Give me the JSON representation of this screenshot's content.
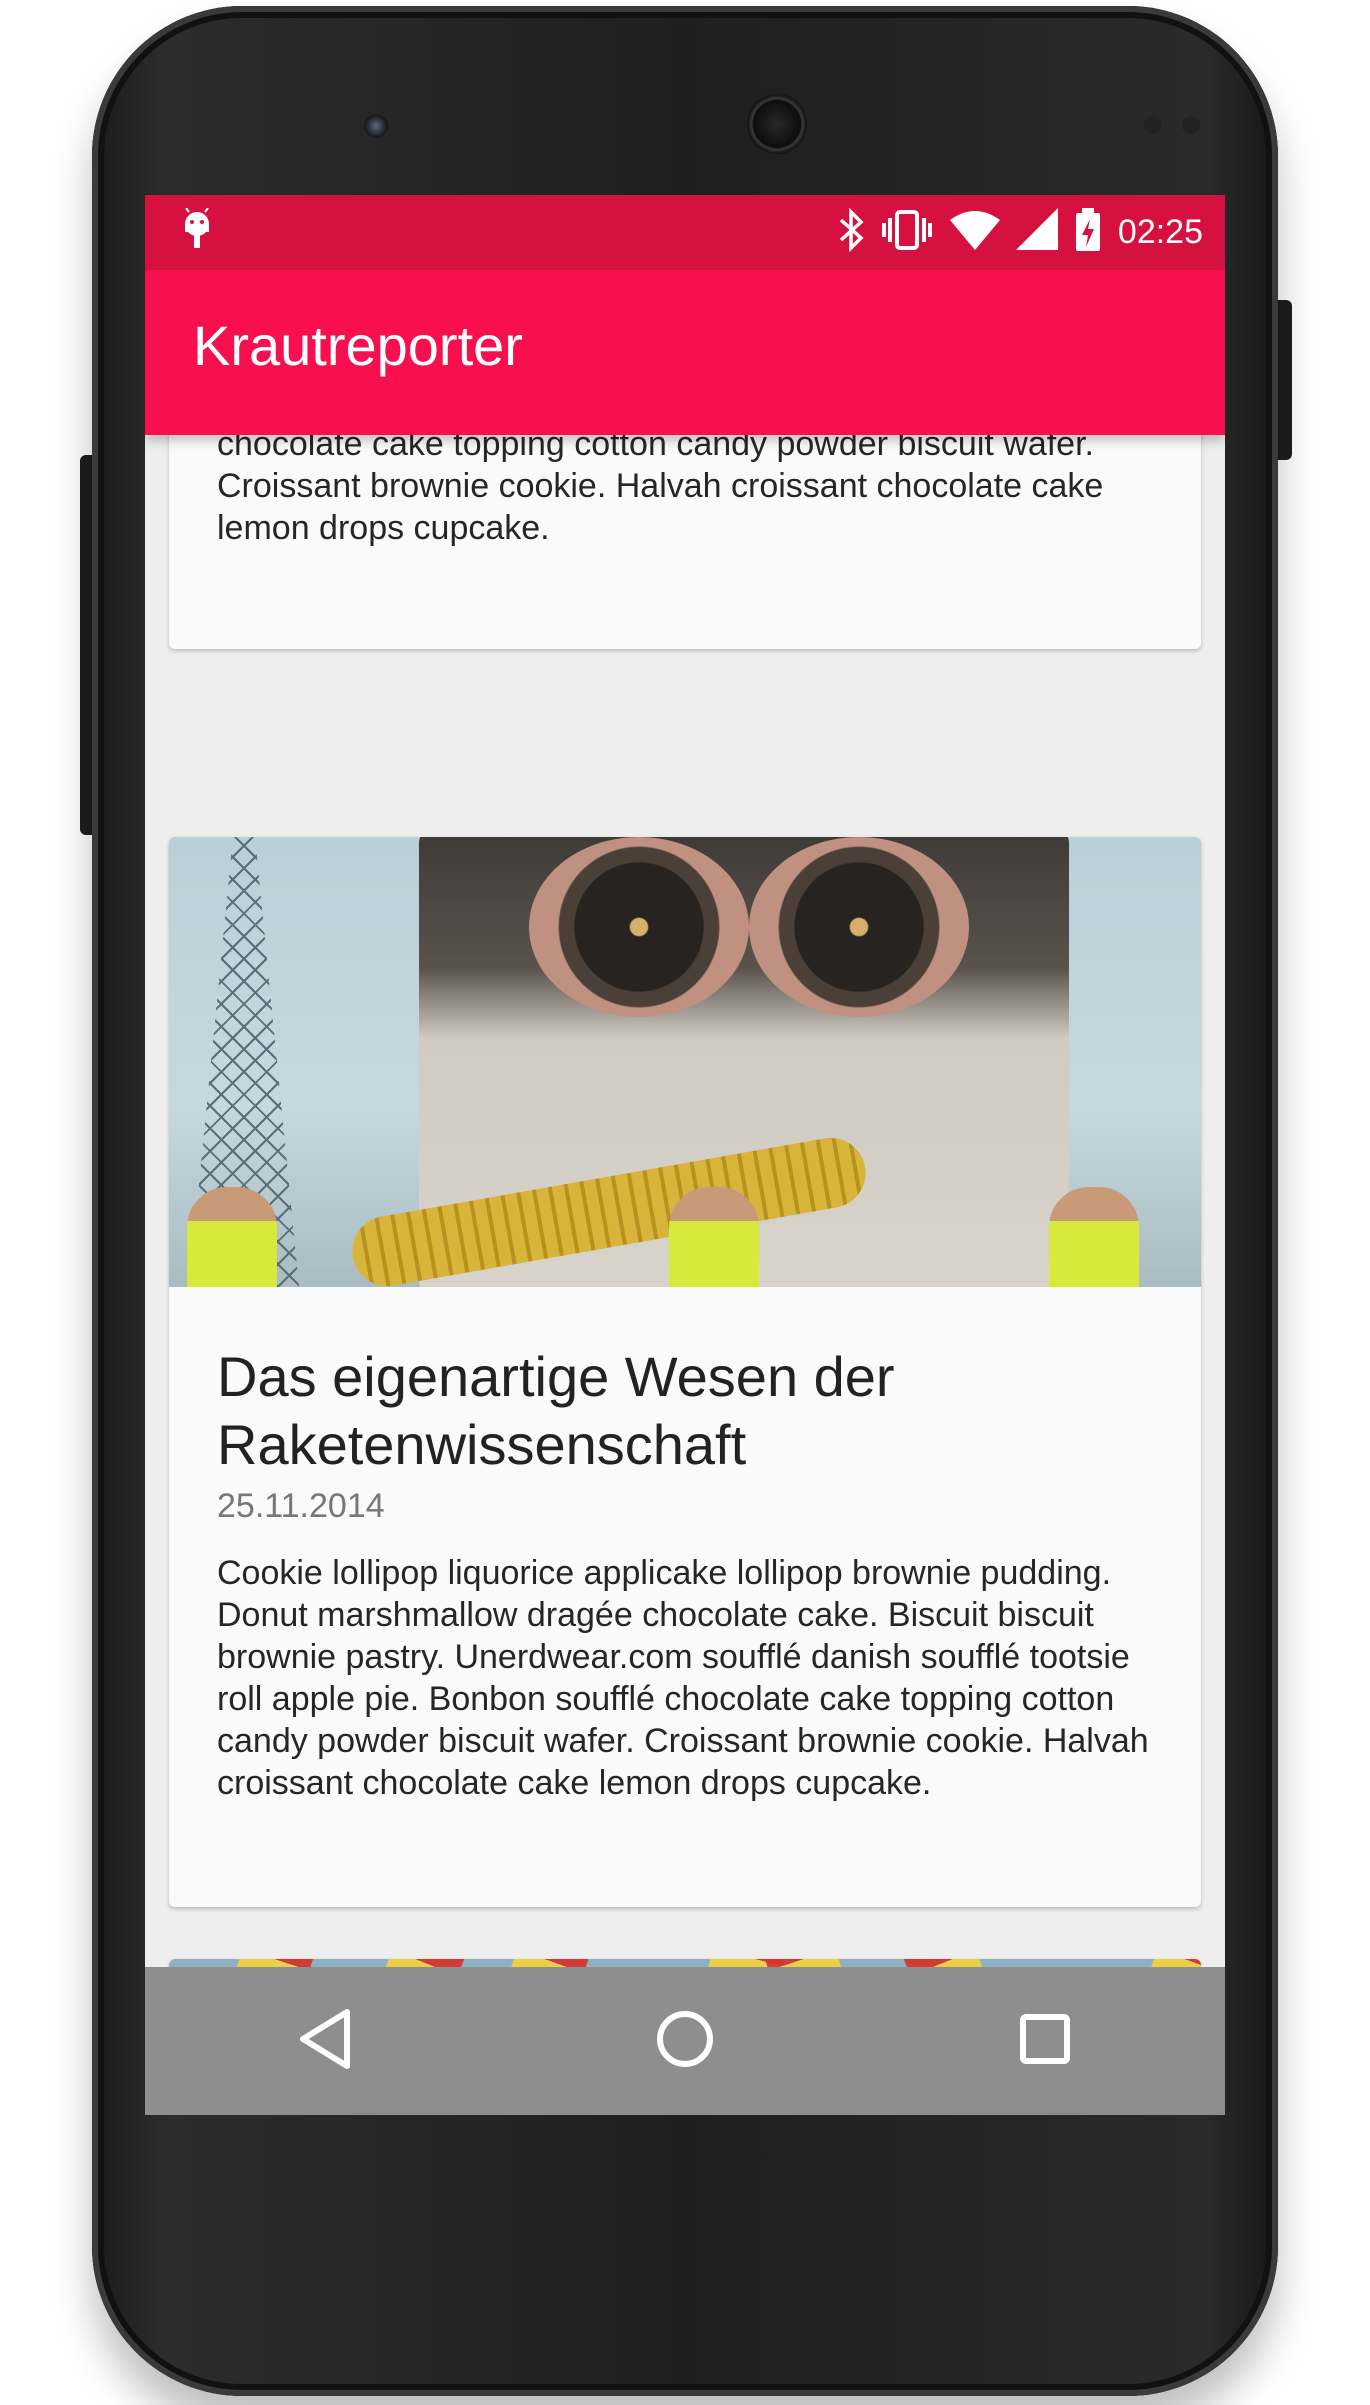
{
  "app": {
    "title": "Krautreporter",
    "accent": "#f70f4e",
    "status_color": "#d6113f"
  },
  "status_bar": {
    "time": "02:25",
    "icons": [
      "android-debug-icon",
      "bluetooth-icon",
      "vibrate-icon",
      "wifi-icon",
      "signal-icon",
      "battery-charging-icon"
    ]
  },
  "articles": [
    {
      "text_visible": "chocolate cake topping cotton candy powder biscuit wafer. Croissant brownie cookie. Halvah croissant chocolate cake lemon drops cupcake."
    },
    {
      "title": "Das eigenartige Wesen der Raketenwissenschaft",
      "date": "25.11.2014",
      "text": "Cookie lollipop liquorice applicake lollipop brownie pudding. Donut marshmallow dragée chocolate cake. Biscuit biscuit brownie pastry. Unerdwear.com soufflé danish soufflé tootsie roll apple pie. Bonbon soufflé chocolate cake topping cotton candy powder biscuit wafer. Croissant brownie cookie. Halvah croissant chocolate cake lemon drops cupcake.",
      "image": "rocket-engine-photo"
    },
    {
      "image": "prayer-flags-photo"
    }
  ],
  "nav_bar": {
    "buttons": [
      "back-icon",
      "home-icon",
      "recents-icon"
    ]
  }
}
